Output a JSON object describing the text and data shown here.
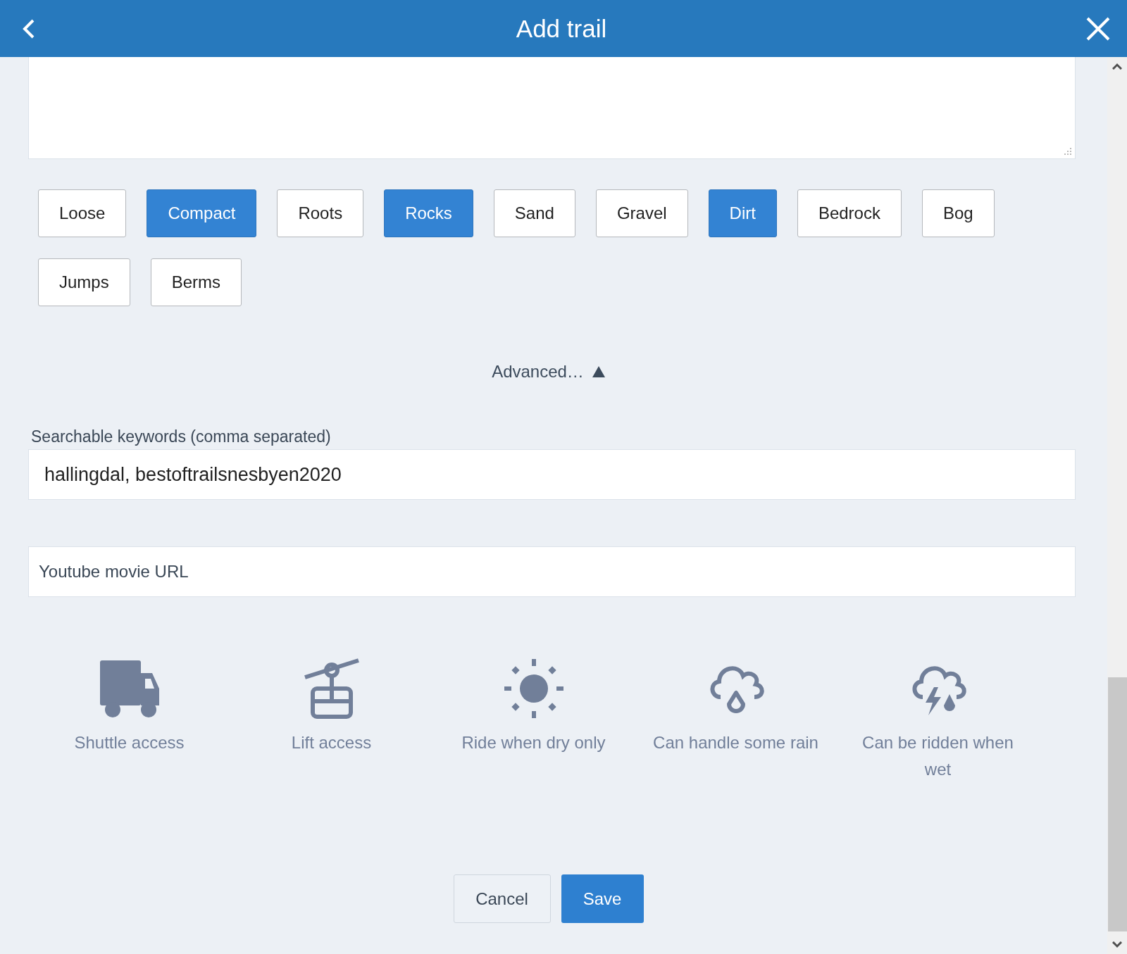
{
  "header": {
    "title": "Add trail"
  },
  "surface_tags": [
    {
      "label": "Loose",
      "selected": false
    },
    {
      "label": "Compact",
      "selected": true
    },
    {
      "label": "Roots",
      "selected": false
    },
    {
      "label": "Rocks",
      "selected": true
    },
    {
      "label": "Sand",
      "selected": false
    },
    {
      "label": "Gravel",
      "selected": false
    },
    {
      "label": "Dirt",
      "selected": true
    },
    {
      "label": "Bedrock",
      "selected": false
    },
    {
      "label": "Bog",
      "selected": false
    },
    {
      "label": "Jumps",
      "selected": false
    },
    {
      "label": "Berms",
      "selected": false
    }
  ],
  "advanced": {
    "label": "Advanced…",
    "expanded": true
  },
  "keywords": {
    "label": "Searchable keywords (comma separated)",
    "value": "hallingdal, bestoftrailsnesbyen2020"
  },
  "youtube": {
    "placeholder": "Youtube movie URL"
  },
  "features": [
    {
      "kind": "shuttle",
      "label": "Shuttle access",
      "selected": false
    },
    {
      "kind": "lift",
      "label": "Lift access",
      "selected": false
    },
    {
      "kind": "dry",
      "label": "Ride when dry only",
      "selected": false
    },
    {
      "kind": "rain",
      "label": "Can handle some rain",
      "selected": false
    },
    {
      "kind": "wet",
      "label": "Can be ridden when wet",
      "selected": false
    }
  ],
  "buttons": {
    "cancel": "Cancel",
    "save": "Save"
  }
}
